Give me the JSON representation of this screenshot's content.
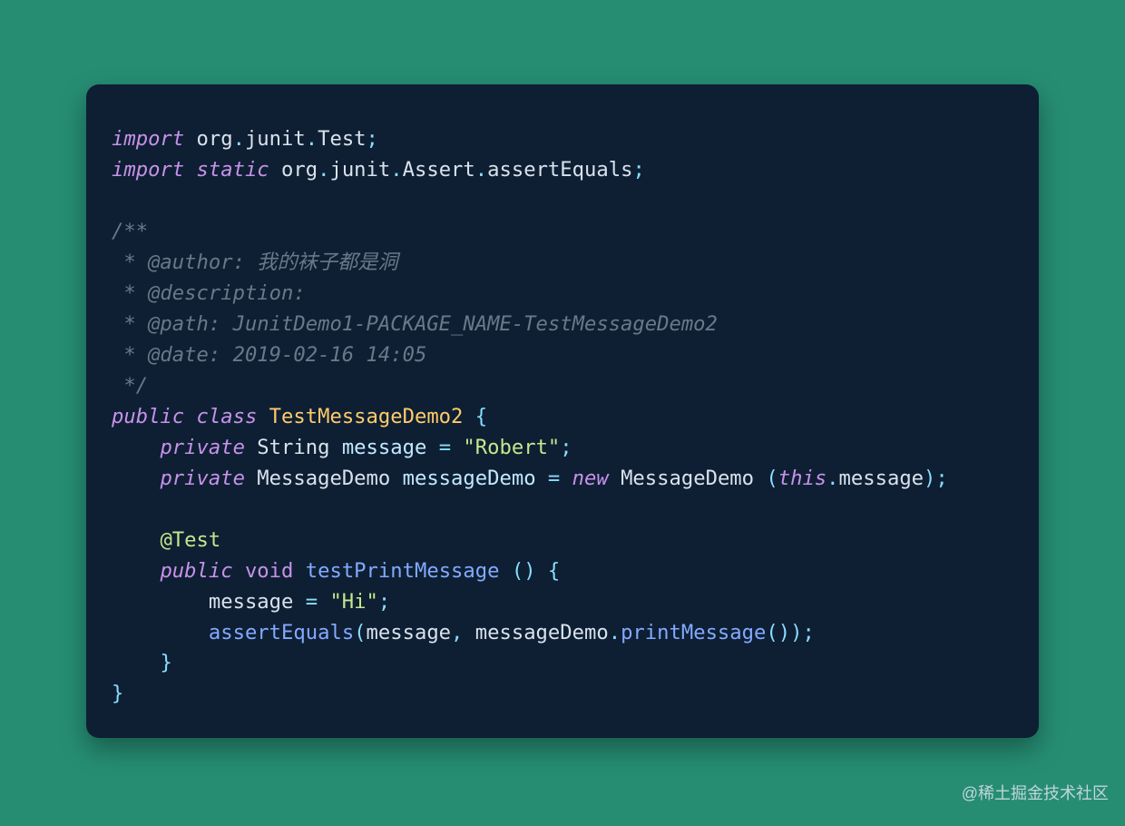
{
  "colors": {
    "page_bg": "#268d73",
    "card_bg": "#0e1f33",
    "text": "#d9e2ec",
    "keyword": "#c792ea",
    "punct": "#89ddff",
    "comment": "#6a7889",
    "class": "#ffcb6b",
    "ident": "#c3e8ff",
    "string": "#c3e88d",
    "anno": "#c3e88d",
    "func": "#82aaff"
  },
  "watermark": "@稀土掘金技术社区",
  "code": {
    "language": "java",
    "tokens": [
      [
        [
          "kw-i",
          "import"
        ],
        [
          "plain",
          " org"
        ],
        [
          "punct",
          "."
        ],
        [
          "plain",
          "junit"
        ],
        [
          "punct",
          "."
        ],
        [
          "plain",
          "Test"
        ],
        [
          "punct",
          ";"
        ]
      ],
      [
        [
          "kw-i",
          "import"
        ],
        [
          "plain",
          " "
        ],
        [
          "kw-i",
          "static"
        ],
        [
          "plain",
          " org"
        ],
        [
          "punct",
          "."
        ],
        [
          "plain",
          "junit"
        ],
        [
          "punct",
          "."
        ],
        [
          "plain",
          "Assert"
        ],
        [
          "punct",
          "."
        ],
        [
          "plain",
          "assertEquals"
        ],
        [
          "punct",
          ";"
        ]
      ],
      [],
      [
        [
          "comment",
          "/**"
        ]
      ],
      [
        [
          "comment",
          " * @author: 我的袜子都是洞"
        ]
      ],
      [
        [
          "comment",
          " * @description:"
        ]
      ],
      [
        [
          "comment",
          " * @path: JunitDemo1-PACKAGE_NAME-TestMessageDemo2"
        ]
      ],
      [
        [
          "comment",
          " * @date: 2019-02-16 14:05"
        ]
      ],
      [
        [
          "comment",
          " */"
        ]
      ],
      [
        [
          "kw-i",
          "public"
        ],
        [
          "plain",
          " "
        ],
        [
          "kw-i",
          "class"
        ],
        [
          "plain",
          " "
        ],
        [
          "class",
          "TestMessageDemo2"
        ],
        [
          "plain",
          " "
        ],
        [
          "punct",
          "{"
        ]
      ],
      [
        [
          "plain",
          "    "
        ],
        [
          "kw-i",
          "private"
        ],
        [
          "plain",
          " String "
        ],
        [
          "ident",
          "message"
        ],
        [
          "plain",
          " "
        ],
        [
          "punct",
          "="
        ],
        [
          "plain",
          " "
        ],
        [
          "string",
          "\"Robert\""
        ],
        [
          "punct",
          ";"
        ]
      ],
      [
        [
          "plain",
          "    "
        ],
        [
          "kw-i",
          "private"
        ],
        [
          "plain",
          " MessageDemo "
        ],
        [
          "ident",
          "messageDemo"
        ],
        [
          "plain",
          " "
        ],
        [
          "punct",
          "="
        ],
        [
          "plain",
          " "
        ],
        [
          "kw-i",
          "new"
        ],
        [
          "plain",
          " MessageDemo "
        ],
        [
          "punct",
          "("
        ],
        [
          "kw-i",
          "this"
        ],
        [
          "punct",
          "."
        ],
        [
          "plain",
          "message"
        ],
        [
          "punct",
          ")"
        ],
        [
          "punct",
          ";"
        ]
      ],
      [],
      [
        [
          "plain",
          "    "
        ],
        [
          "anno",
          "@Test"
        ]
      ],
      [
        [
          "plain",
          "    "
        ],
        [
          "kw-i",
          "public"
        ],
        [
          "plain",
          " "
        ],
        [
          "void",
          "void"
        ],
        [
          "plain",
          " "
        ],
        [
          "func",
          "testPrintMessage"
        ],
        [
          "plain",
          " "
        ],
        [
          "punct",
          "("
        ],
        [
          "punct",
          ")"
        ],
        [
          "plain",
          " "
        ],
        [
          "punct",
          "{"
        ]
      ],
      [
        [
          "plain",
          "        message "
        ],
        [
          "punct",
          "="
        ],
        [
          "plain",
          " "
        ],
        [
          "string",
          "\"Hi\""
        ],
        [
          "punct",
          ";"
        ]
      ],
      [
        [
          "plain",
          "        "
        ],
        [
          "func",
          "assertEquals"
        ],
        [
          "punct",
          "("
        ],
        [
          "plain",
          "message"
        ],
        [
          "punct",
          ","
        ],
        [
          "plain",
          " messageDemo"
        ],
        [
          "punct",
          "."
        ],
        [
          "func",
          "printMessage"
        ],
        [
          "punct",
          "("
        ],
        [
          "punct",
          ")"
        ],
        [
          "punct",
          ")"
        ],
        [
          "punct",
          ";"
        ]
      ],
      [
        [
          "plain",
          "    "
        ],
        [
          "punct",
          "}"
        ]
      ],
      [
        [
          "punct",
          "}"
        ]
      ]
    ]
  }
}
